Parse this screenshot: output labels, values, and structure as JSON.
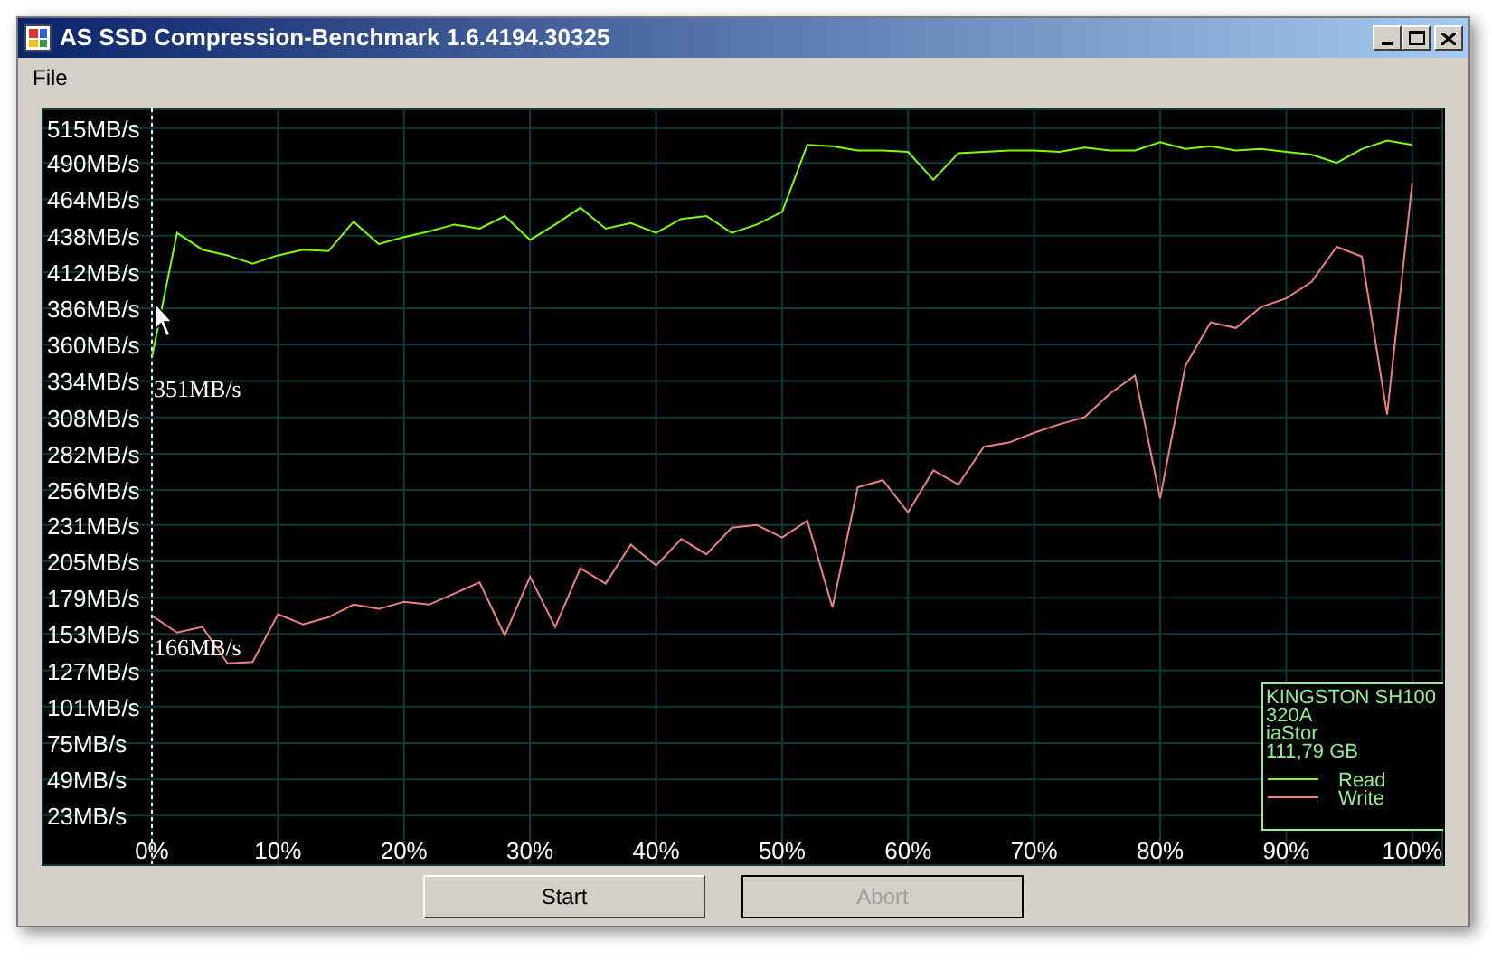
{
  "window": {
    "title": "AS SSD Compression-Benchmark 1.6.4194.30325"
  },
  "menu": [
    "File"
  ],
  "chart": {
    "chart_data": {
      "type": "line",
      "x": [
        0,
        2,
        4,
        6,
        8,
        10,
        12,
        14,
        16,
        18,
        20,
        22,
        24,
        26,
        28,
        30,
        32,
        34,
        36,
        38,
        40,
        42,
        44,
        46,
        48,
        50,
        52,
        54,
        56,
        58,
        60,
        62,
        64,
        66,
        68,
        70,
        72,
        74,
        76,
        78,
        80,
        82,
        84,
        86,
        88,
        90,
        92,
        94,
        96,
        98,
        100
      ],
      "series": [
        {
          "name": "Read",
          "color": "#7fff00",
          "values": [
            351,
            440,
            428,
            424,
            418,
            424,
            428,
            427,
            448,
            432,
            437,
            441,
            446,
            443,
            452,
            435,
            446,
            458,
            443,
            447,
            440,
            450,
            452,
            440,
            446,
            455,
            503,
            502,
            499,
            499,
            498,
            478,
            497,
            498,
            499,
            499,
            498,
            501,
            499,
            499,
            505,
            500,
            502,
            499,
            500,
            498,
            496,
            490,
            500,
            506,
            503
          ]
        },
        {
          "name": "Write",
          "color": "#f08080",
          "values": [
            166,
            154,
            158,
            132,
            133,
            167,
            160,
            165,
            174,
            171,
            176,
            174,
            182,
            190,
            152,
            194,
            158,
            200,
            189,
            217,
            202,
            221,
            210,
            229,
            231,
            222,
            234,
            172,
            258,
            263,
            240,
            270,
            260,
            287,
            290,
            297,
            303,
            308,
            325,
            338,
            250,
            345,
            376,
            372,
            387,
            393,
            405,
            430,
            423,
            310,
            476
          ]
        }
      ],
      "yticks": [
        {
          "value": 515,
          "label": "515MB/s"
        },
        {
          "value": 490,
          "label": "490MB/s"
        },
        {
          "value": 464,
          "label": "464MB/s"
        },
        {
          "value": 438,
          "label": "438MB/s"
        },
        {
          "value": 412,
          "label": "412MB/s"
        },
        {
          "value": 386,
          "label": "386MB/s"
        },
        {
          "value": 360,
          "label": "360MB/s"
        },
        {
          "value": 334,
          "label": "334MB/s"
        },
        {
          "value": 308,
          "label": "308MB/s"
        },
        {
          "value": 282,
          "label": "282MB/s"
        },
        {
          "value": 256,
          "label": "256MB/s"
        },
        {
          "value": 231,
          "label": "231MB/s"
        },
        {
          "value": 205,
          "label": "205MB/s"
        },
        {
          "value": 179,
          "label": "179MB/s"
        },
        {
          "value": 153,
          "label": "153MB/s"
        },
        {
          "value": 127,
          "label": "127MB/s"
        },
        {
          "value": 101,
          "label": "101MB/s"
        },
        {
          "value": 75,
          "label": "75MB/s"
        },
        {
          "value": 49,
          "label": "49MB/s"
        },
        {
          "value": 23,
          "label": "23MB/s"
        }
      ],
      "xticks": [
        {
          "value": 0,
          "label": "0%"
        },
        {
          "value": 10,
          "label": "10%"
        },
        {
          "value": 20,
          "label": "20%"
        },
        {
          "value": 30,
          "label": "30%"
        },
        {
          "value": 40,
          "label": "40%"
        },
        {
          "value": 50,
          "label": "50%"
        },
        {
          "value": 60,
          "label": "60%"
        },
        {
          "value": 70,
          "label": "70%"
        },
        {
          "value": 80,
          "label": "80%"
        },
        {
          "value": 90,
          "label": "90%"
        },
        {
          "value": 100,
          "label": "100%"
        }
      ],
      "xlim": [
        -8.75,
        102.45
      ],
      "grid": true,
      "legend": true,
      "ref_lines": [
        {
          "axis": "x",
          "value": 0
        }
      ],
      "ylim": [
        -13,
        529
      ],
      "annotations": [
        {
          "text": "351MB/s",
          "x": 0,
          "y": 351
        },
        {
          "text": "166MB/s",
          "x": 0,
          "y": 166
        }
      ]
    },
    "device_info": [
      "KINGSTON SH100",
      "320A",
      "iaStor",
      "111,79 GB"
    ]
  },
  "buttons": [
    {
      "label": "Start",
      "disabled": false
    },
    {
      "label": "Abort",
      "disabled": true
    }
  ]
}
